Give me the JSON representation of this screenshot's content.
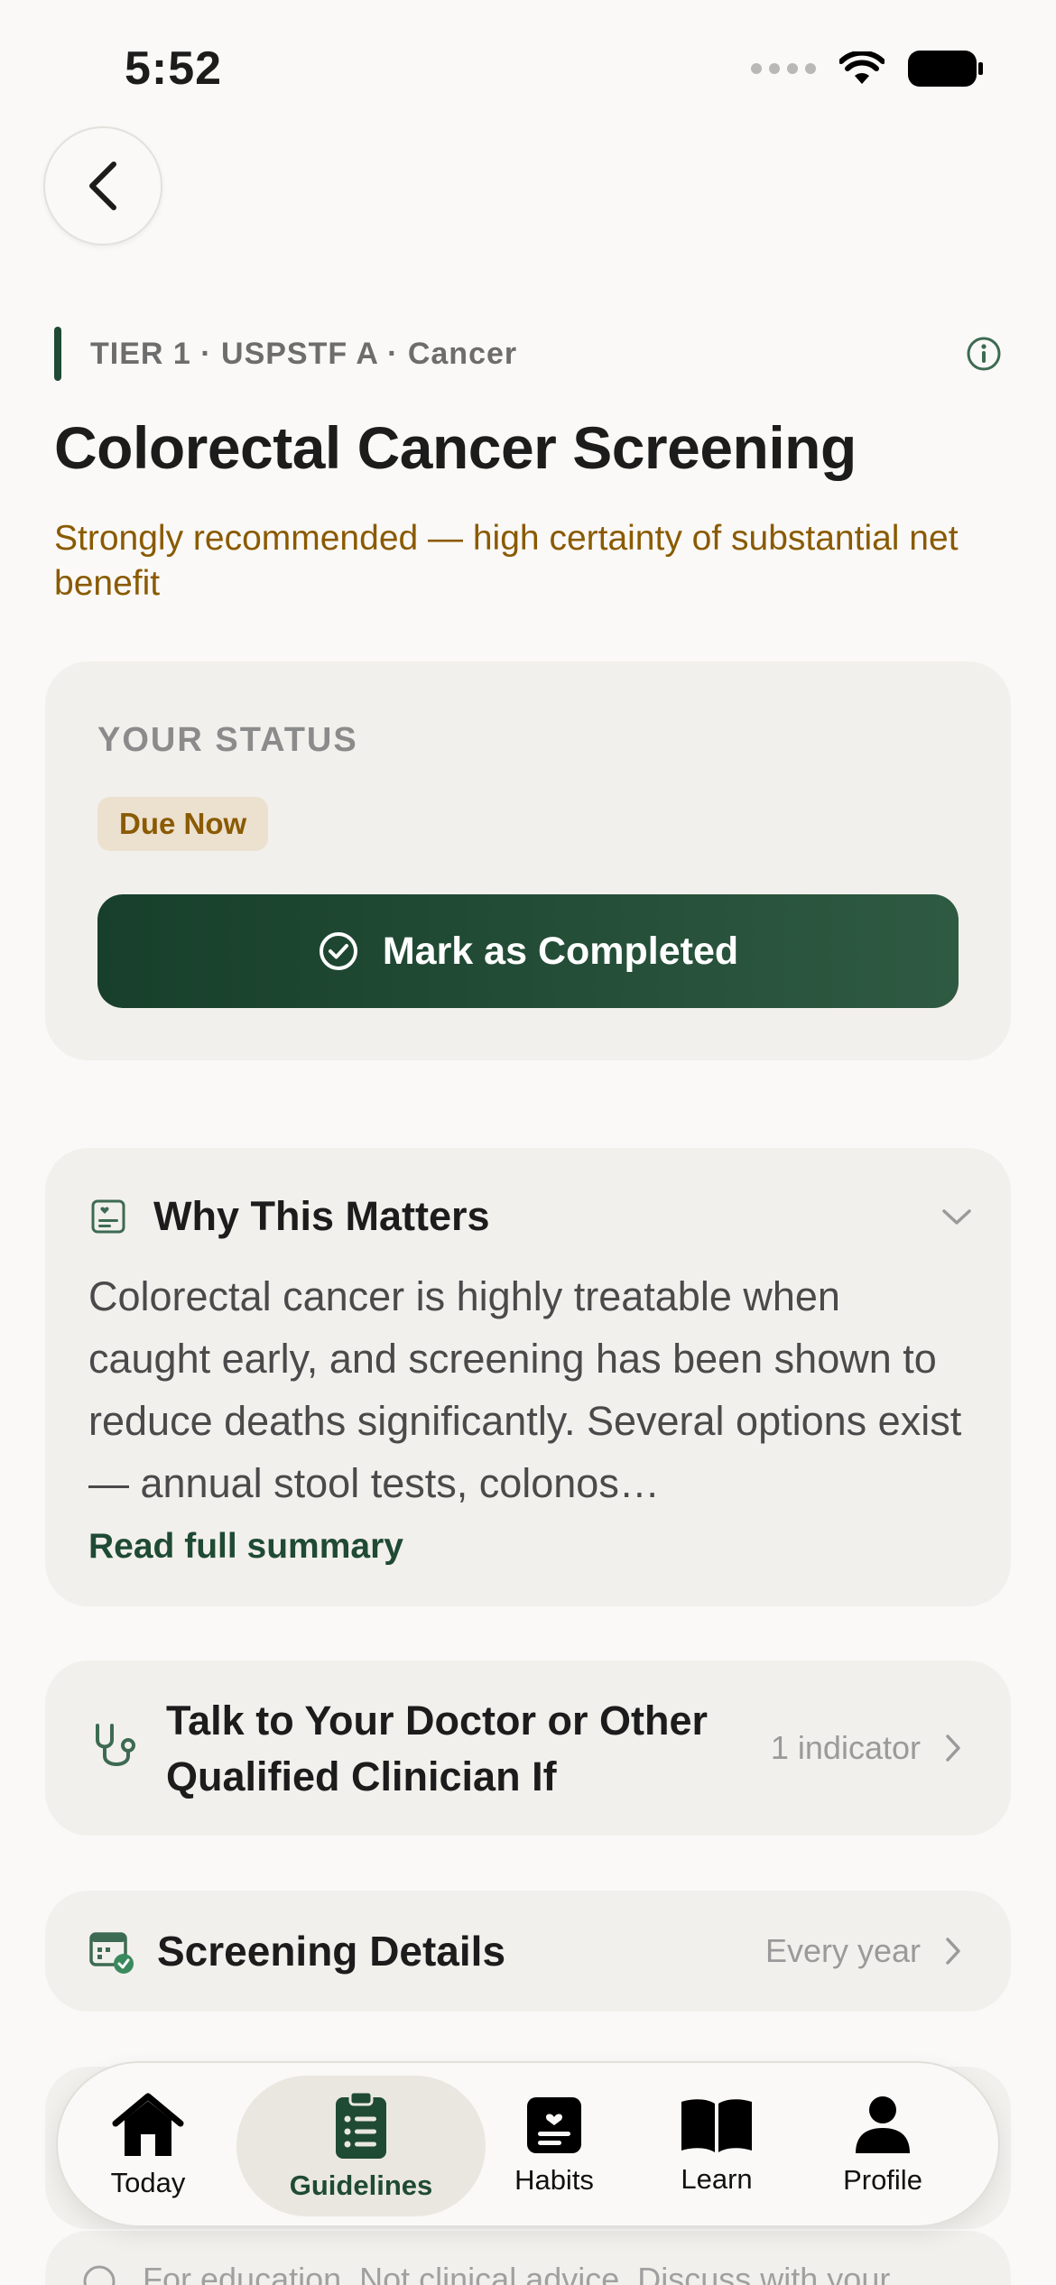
{
  "status_bar": {
    "time": "5:52"
  },
  "header": {
    "tier": "TIER 1 · USPSTF A · Cancer",
    "title": "Colorectal Cancer Screening",
    "subtitle": "Strongly recommended — high certainty of substantial net benefit"
  },
  "status_card": {
    "label": "YOUR STATUS",
    "badge": "Due Now",
    "button_label": "Mark as Completed"
  },
  "why": {
    "title": "Why This Matters",
    "body": "Colorectal cancer is highly treatable when caught early, and screening has been shown to reduce deaths significantly. Several options exist — annual stool tests, colonos…",
    "link": "Read full summary"
  },
  "talk": {
    "title": "Talk to Your Doctor or Other Qualified Clinician If",
    "meta": "1 indicator"
  },
  "screening": {
    "title": "Screening Details",
    "meta": "Every year"
  },
  "footer": {
    "disclaimer": "For education. Not clinical advice. Discuss with your"
  },
  "tabs": [
    {
      "label": "Today",
      "icon": "house-icon"
    },
    {
      "label": "Guidelines",
      "icon": "clipboard-icon",
      "active": true
    },
    {
      "label": "Habits",
      "icon": "notebook-icon"
    },
    {
      "label": "Learn",
      "icon": "book-icon"
    },
    {
      "label": "Profile",
      "icon": "person-icon"
    }
  ],
  "colors": {
    "brand_green": "#1f4a33",
    "accent_amber": "#8a5a00",
    "card_bg": "#f2f0ec",
    "page_bg": "#faf9f7"
  }
}
